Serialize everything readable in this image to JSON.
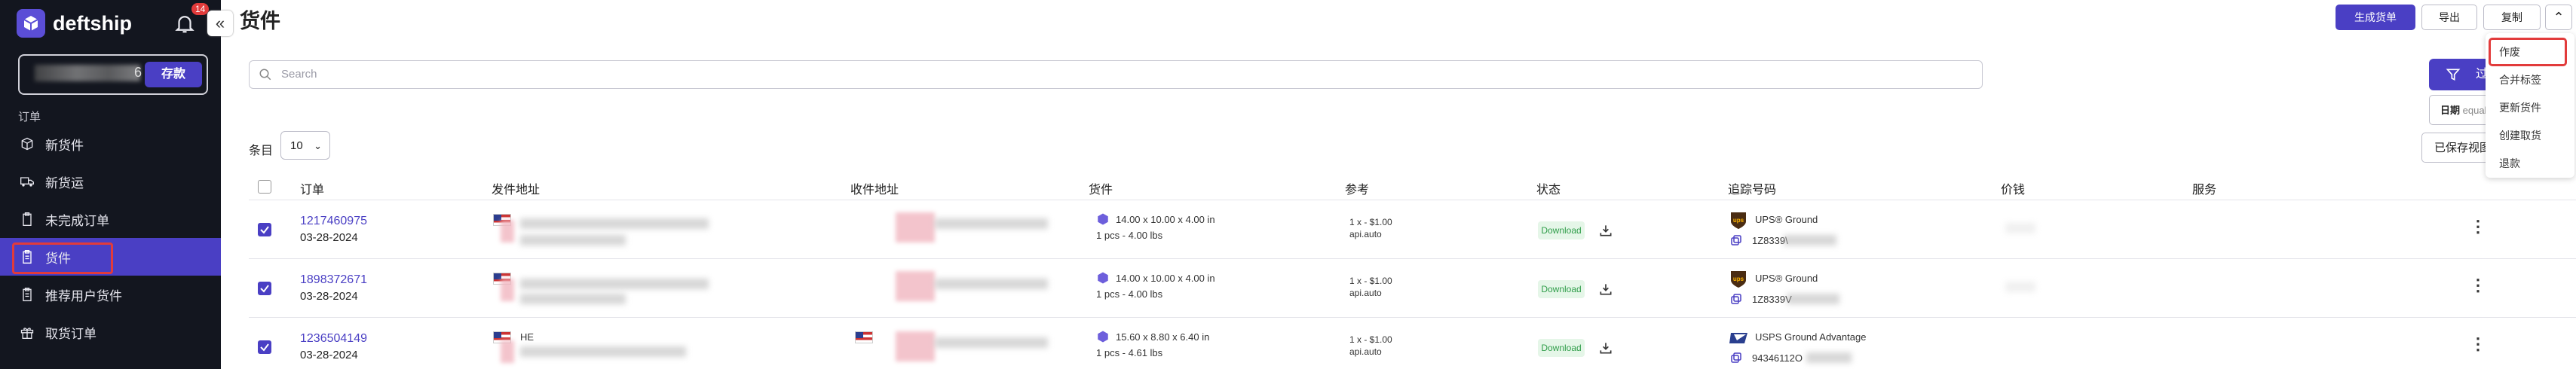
{
  "brand": {
    "name": "deftship",
    "accent": "#4a3fc4",
    "sidebar_bg": "#13161f"
  },
  "header": {
    "notification_count": "14",
    "collapse_glyph": "«",
    "page_title": "货件"
  },
  "sidebar": {
    "balance_tail": "6",
    "deposit_label": "存款",
    "section_label": "订单",
    "items": [
      {
        "label": "新货件",
        "icon": "package-icon"
      },
      {
        "label": "新货运",
        "icon": "truck-icon"
      },
      {
        "label": "未完成订单",
        "icon": "clipboard-icon"
      },
      {
        "label": "货件",
        "icon": "clipboard-icon",
        "active": true
      },
      {
        "label": "推荐用户货件",
        "icon": "clipboard-icon"
      },
      {
        "label": "取货订单",
        "icon": "gift-icon"
      }
    ]
  },
  "toolbar": {
    "generate_label": "生成货单",
    "export_label": "导出",
    "copy_label": "复制",
    "filter_label": "过滤",
    "date_label": "日期",
    "date_op": "equals",
    "saved_views_label": "已保存视图"
  },
  "dropdown": {
    "items": [
      "作废",
      "合并标签",
      "更新货件",
      "创建取货",
      "退款"
    ]
  },
  "search": {
    "placeholder": "Search"
  },
  "pagination": {
    "entries_label": "条目",
    "page_size": "10"
  },
  "table": {
    "headers": [
      "订单",
      "发件地址",
      "收件地址",
      "货件",
      "参考",
      "状态",
      "追踪号码",
      "价钱",
      "服务"
    ],
    "rows": [
      {
        "order_id": "1217460975",
        "date": "03-28-2024",
        "sender_name": "",
        "dims": "14.00 x 10.00 x 4.00 in",
        "pkg": "1 pcs - 4.00 lbs",
        "ref1": "1 x - $1.00",
        "ref2": "api.auto",
        "status": "Download",
        "carrier": "UPS",
        "service": "UPS® Ground",
        "tracking": "1Z8339\\"
      },
      {
        "order_id": "1898372671",
        "date": "03-28-2024",
        "sender_name": "",
        "dims": "14.00 x 10.00 x 4.00 in",
        "pkg": "1 pcs - 4.00 lbs",
        "ref1": "1 x - $1.00",
        "ref2": "api.auto",
        "status": "Download",
        "carrier": "UPS",
        "service": "UPS® Ground",
        "tracking": "1Z8339V"
      },
      {
        "order_id": "1236504149",
        "date": "03-28-2024",
        "sender_name": "HE",
        "dims": "15.60 x 8.80 x 6.40 in",
        "pkg": "1 pcs - 4.61 lbs",
        "ref1": "1 x - $1.00",
        "ref2": "api.auto",
        "status": "Download",
        "carrier": "USPS",
        "service": "USPS Ground Advantage",
        "tracking": "94346112O"
      }
    ]
  }
}
